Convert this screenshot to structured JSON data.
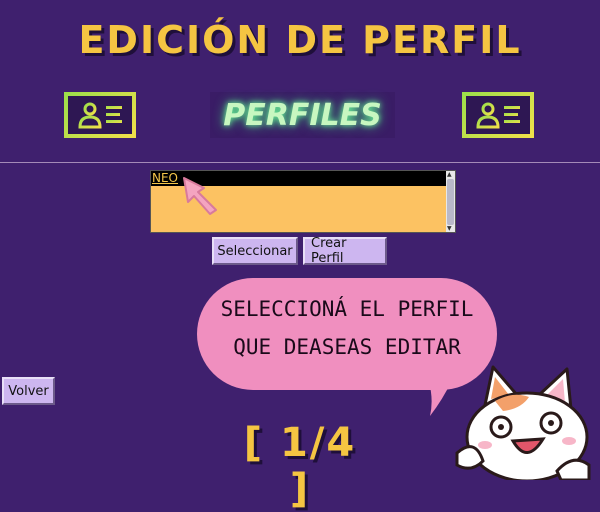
{
  "header": {
    "title": "EDICIÓN DE PERFIL",
    "section_label": "PERFILES"
  },
  "profiles": {
    "items": [
      "NEO"
    ],
    "selected_index": 0
  },
  "buttons": {
    "select_label": "Seleccionar",
    "create_label": "Crear Perfil",
    "back_label": "Volver"
  },
  "tutorial": {
    "line1": "SELECCIONÁ EL PERFIL",
    "line2": "QUE DEASEAS EDITAR"
  },
  "step": {
    "counter": "[ 1/4 ]"
  },
  "icons": {
    "left_card": "id-card-icon",
    "right_card": "id-card-icon",
    "pointer": "hand-pointer-icon",
    "mascot": "cat-mascot"
  },
  "colors": {
    "background": "#3f206e",
    "title": "#f5c542",
    "list_bg": "#fcc262",
    "button_bg": "#cdb6f0",
    "bubble": "#f08fbf"
  }
}
